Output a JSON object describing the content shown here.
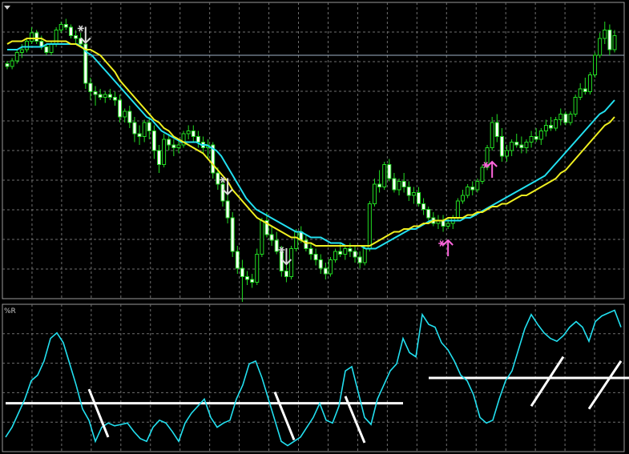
{
  "indicator_label": "%R",
  "colors": {
    "background": "#000000",
    "candle": "#22dd22",
    "candle_body_up": "#000000",
    "candle_body_down": "#ffffff",
    "fast_ma": "#22e0f0",
    "slow_ma": "#f0f020",
    "level_line": "#9fb4c8",
    "sell_arrow": "#d8d8d8",
    "buy_arrow": "#ff66dd",
    "wpr_line": "#22e0f0",
    "threshold_line": "#ffffff",
    "signal_stroke": "#ffffff",
    "grid": "#6f6f6f"
  },
  "chart_data": [
    {
      "type": "candlestick",
      "pane": "price",
      "ylim": [
        0,
        100
      ],
      "grid": true,
      "level_line": 84,
      "candles_ohlc": [
        [
          81,
          82,
          79,
          80
        ],
        [
          80,
          83,
          79,
          82
        ],
        [
          82,
          86,
          81,
          85
        ],
        [
          85,
          88,
          83,
          86
        ],
        [
          86,
          90,
          85,
          89
        ],
        [
          89,
          94,
          88,
          92
        ],
        [
          92,
          93,
          88,
          89
        ],
        [
          89,
          91,
          86,
          87
        ],
        [
          87,
          88,
          84,
          85
        ],
        [
          85,
          89,
          84,
          88
        ],
        [
          88,
          94,
          87,
          93
        ],
        [
          93,
          96,
          92,
          95
        ],
        [
          95,
          97,
          93,
          94
        ],
        [
          94,
          95,
          90,
          91
        ],
        [
          91,
          93,
          88,
          90
        ],
        [
          90,
          92,
          87,
          88
        ],
        [
          88,
          89,
          72,
          74
        ],
        [
          74,
          76,
          68,
          71
        ],
        [
          71,
          73,
          66,
          70
        ],
        [
          70,
          72,
          68,
          69
        ],
        [
          69,
          71,
          67,
          70
        ],
        [
          70,
          72,
          68,
          69
        ],
        [
          69,
          71,
          66,
          68
        ],
        [
          68,
          70,
          60,
          62
        ],
        [
          62,
          65,
          60,
          64
        ],
        [
          64,
          66,
          58,
          60
        ],
        [
          60,
          62,
          53,
          56
        ],
        [
          56,
          59,
          52,
          55
        ],
        [
          55,
          61,
          53,
          60
        ],
        [
          60,
          62,
          54,
          57
        ],
        [
          57,
          59,
          47,
          50
        ],
        [
          50,
          52,
          42,
          45
        ],
        [
          45,
          56,
          44,
          54
        ],
        [
          54,
          56,
          50,
          52
        ],
        [
          52,
          54,
          48,
          51
        ],
        [
          51,
          54,
          49,
          52
        ],
        [
          52,
          57,
          51,
          56
        ],
        [
          56,
          59,
          54,
          57
        ],
        [
          57,
          59,
          53,
          55
        ],
        [
          55,
          57,
          51,
          53
        ],
        [
          53,
          55,
          49,
          51
        ],
        [
          51,
          54,
          47,
          52
        ],
        [
          52,
          53,
          40,
          42
        ],
        [
          42,
          44,
          36,
          38
        ],
        [
          38,
          40,
          30,
          32
        ],
        [
          32,
          35,
          24,
          26
        ],
        [
          26,
          28,
          12,
          14
        ],
        [
          14,
          16,
          6,
          8
        ],
        [
          8,
          11,
          -4,
          5
        ],
        [
          5,
          7,
          2,
          4
        ],
        [
          4,
          6,
          1,
          3
        ],
        [
          3,
          15,
          2,
          13
        ],
        [
          13,
          26,
          12,
          25
        ],
        [
          25,
          28,
          19,
          20
        ],
        [
          20,
          23,
          16,
          18
        ],
        [
          18,
          21,
          13,
          14
        ],
        [
          14,
          16,
          5,
          7
        ],
        [
          7,
          10,
          3,
          5
        ],
        [
          5,
          16,
          4,
          15
        ],
        [
          15,
          22,
          14,
          21
        ],
        [
          21,
          23,
          17,
          18
        ],
        [
          18,
          20,
          14,
          15
        ],
        [
          15,
          17,
          11,
          13
        ],
        [
          13,
          15,
          9,
          11
        ],
        [
          11,
          13,
          6,
          8
        ],
        [
          8,
          10,
          4,
          6
        ],
        [
          6,
          12,
          5,
          11
        ],
        [
          11,
          15,
          10,
          14
        ],
        [
          14,
          17,
          12,
          13
        ],
        [
          13,
          16,
          11,
          15
        ],
        [
          15,
          17,
          12,
          14
        ],
        [
          14,
          16,
          10,
          12
        ],
        [
          12,
          14,
          8,
          10
        ],
        [
          10,
          16,
          9,
          15
        ],
        [
          15,
          32,
          14,
          31
        ],
        [
          31,
          40,
          30,
          38
        ],
        [
          38,
          43,
          35,
          37
        ],
        [
          37,
          46,
          36,
          45
        ],
        [
          45,
          47,
          39,
          40
        ],
        [
          40,
          42,
          35,
          36
        ],
        [
          36,
          40,
          34,
          39
        ],
        [
          39,
          42,
          35,
          37
        ],
        [
          37,
          39,
          32,
          34
        ],
        [
          34,
          37,
          31,
          35
        ],
        [
          35,
          37,
          30,
          31
        ],
        [
          31,
          33,
          27,
          29
        ],
        [
          29,
          30,
          25,
          26
        ],
        [
          26,
          28,
          23,
          24
        ],
        [
          24,
          27,
          22,
          25
        ],
        [
          25,
          27,
          21,
          23
        ],
        [
          23,
          26,
          22,
          24
        ],
        [
          24,
          27,
          22,
          26
        ],
        [
          26,
          33,
          25,
          32
        ],
        [
          32,
          36,
          31,
          34
        ],
        [
          34,
          38,
          33,
          37
        ],
        [
          37,
          39,
          34,
          36
        ],
        [
          36,
          40,
          35,
          39
        ],
        [
          39,
          45,
          38,
          44
        ],
        [
          44,
          52,
          43,
          51
        ],
        [
          51,
          62,
          50,
          60
        ],
        [
          60,
          63,
          53,
          55
        ],
        [
          55,
          58,
          46,
          48
        ],
        [
          48,
          52,
          46,
          50
        ],
        [
          50,
          54,
          48,
          53
        ],
        [
          53,
          56,
          51,
          52
        ],
        [
          52,
          55,
          49,
          51
        ],
        [
          51,
          54,
          49,
          53
        ],
        [
          53,
          57,
          51,
          55
        ],
        [
          55,
          58,
          53,
          54
        ],
        [
          54,
          58,
          52,
          57
        ],
        [
          57,
          61,
          55,
          59
        ],
        [
          59,
          62,
          57,
          58
        ],
        [
          58,
          62,
          57,
          61
        ],
        [
          61,
          65,
          59,
          63
        ],
        [
          63,
          64,
          59,
          60
        ],
        [
          60,
          64,
          59,
          63
        ],
        [
          63,
          70,
          62,
          69
        ],
        [
          69,
          74,
          68,
          72
        ],
        [
          72,
          76,
          70,
          71
        ],
        [
          71,
          78,
          70,
          77
        ],
        [
          77,
          85,
          76,
          84
        ],
        [
          84,
          92,
          83,
          90
        ],
        [
          90,
          96,
          88,
          93
        ],
        [
          93,
          95,
          84,
          86
        ],
        [
          86,
          93,
          85,
          91
        ]
      ],
      "moving_averages": [
        {
          "values": [
            86,
            86,
            86,
            87,
            87,
            87,
            87,
            87,
            88,
            88,
            88,
            88,
            88,
            88,
            88,
            87,
            85,
            84,
            82,
            80,
            78,
            76,
            74,
            72,
            70,
            68,
            66,
            64,
            62,
            61,
            59,
            57,
            56,
            55,
            54,
            53,
            53,
            53,
            53,
            52,
            52,
            51,
            50,
            48,
            45,
            42,
            39,
            36,
            33,
            31,
            29,
            28,
            27,
            26,
            25,
            24,
            23,
            22,
            21,
            21,
            20,
            19,
            19,
            19,
            18,
            17,
            17,
            17,
            16,
            16,
            16,
            16,
            15,
            15,
            15,
            16,
            17,
            18,
            19,
            20,
            21,
            22,
            22,
            23,
            24,
            25,
            25,
            25,
            25,
            25,
            25,
            25,
            26,
            26,
            27,
            28,
            29,
            30,
            31,
            32,
            33,
            34,
            35,
            36,
            37,
            38,
            39,
            40,
            41,
            43,
            45,
            47,
            49,
            51,
            53,
            55,
            57,
            59,
            61,
            63,
            64,
            66,
            68
          ]
        },
        {
          "values": [
            88,
            89,
            89,
            89,
            90,
            90,
            90,
            90,
            89,
            89,
            89,
            89,
            89,
            88,
            88,
            87,
            86,
            86,
            85,
            84,
            82,
            80,
            78,
            75,
            73,
            71,
            69,
            67,
            65,
            63,
            61,
            60,
            58,
            57,
            55,
            54,
            53,
            52,
            51,
            50,
            49,
            47,
            45,
            43,
            41,
            39,
            36,
            34,
            32,
            30,
            28,
            26,
            25,
            24,
            23,
            22,
            21,
            20,
            19,
            19,
            18,
            17,
            17,
            16,
            16,
            16,
            16,
            16,
            16,
            16,
            16,
            16,
            16,
            16,
            16,
            17,
            18,
            19,
            20,
            21,
            21,
            22,
            22,
            23,
            23,
            24,
            24,
            25,
            25,
            25,
            26,
            26,
            26,
            26,
            27,
            27,
            28,
            28,
            29,
            30,
            30,
            31,
            31,
            32,
            33,
            34,
            34,
            35,
            36,
            37,
            38,
            39,
            40,
            42,
            43,
            45,
            47,
            49,
            51,
            53,
            55,
            57,
            59,
            60,
            62
          ]
        }
      ],
      "sell_signals": [
        16,
        45,
        57
      ],
      "buy_signals": [
        90,
        99
      ]
    },
    {
      "type": "line",
      "pane": "williams-percent-r",
      "ylim": [
        -100,
        0
      ],
      "grid": true,
      "series_values": [
        -92,
        -85,
        -75,
        -65,
        -52,
        -48,
        -38,
        -22,
        -18,
        -25,
        -40,
        -55,
        -72,
        -80,
        -95,
        -85,
        -82,
        -84,
        -83,
        -82,
        -88,
        -93,
        -95,
        -85,
        -80,
        -82,
        -88,
        -95,
        -82,
        -75,
        -70,
        -65,
        -78,
        -85,
        -82,
        -80,
        -65,
        -55,
        -40,
        -38,
        -50,
        -65,
        -80,
        -95,
        -98,
        -95,
        -92,
        -85,
        -78,
        -68,
        -80,
        -82,
        -70,
        -45,
        -42,
        -60,
        -78,
        -83,
        -65,
        -55,
        -45,
        -40,
        -22,
        -32,
        -35,
        -5,
        -12,
        -14,
        -25,
        -30,
        -38,
        -48,
        -52,
        -62,
        -78,
        -82,
        -80,
        -65,
        -52,
        -45,
        -30,
        -15,
        -5,
        -12,
        -18,
        -22,
        -24,
        -20,
        -14,
        -10,
        -14,
        -24,
        -10,
        -6,
        -4,
        -2,
        -14
      ],
      "threshold_lines": [
        {
          "value": -68,
          "from": 0,
          "to": 62
        },
        {
          "value": -50,
          "from": 66,
          "to": 107
        }
      ],
      "signal_marks": [
        {
          "type": "down",
          "from": [
            13,
            -58
          ],
          "to": [
            16,
            -92
          ]
        },
        {
          "type": "down",
          "from": [
            42,
            -60
          ],
          "to": [
            45,
            -94
          ]
        },
        {
          "type": "down",
          "from": [
            53,
            -63
          ],
          "to": [
            56,
            -96
          ]
        },
        {
          "type": "up",
          "from": [
            82,
            -70
          ],
          "to": [
            87,
            -35
          ]
        },
        {
          "type": "up",
          "from": [
            91,
            -72
          ],
          "to": [
            96,
            -38
          ]
        }
      ]
    }
  ]
}
